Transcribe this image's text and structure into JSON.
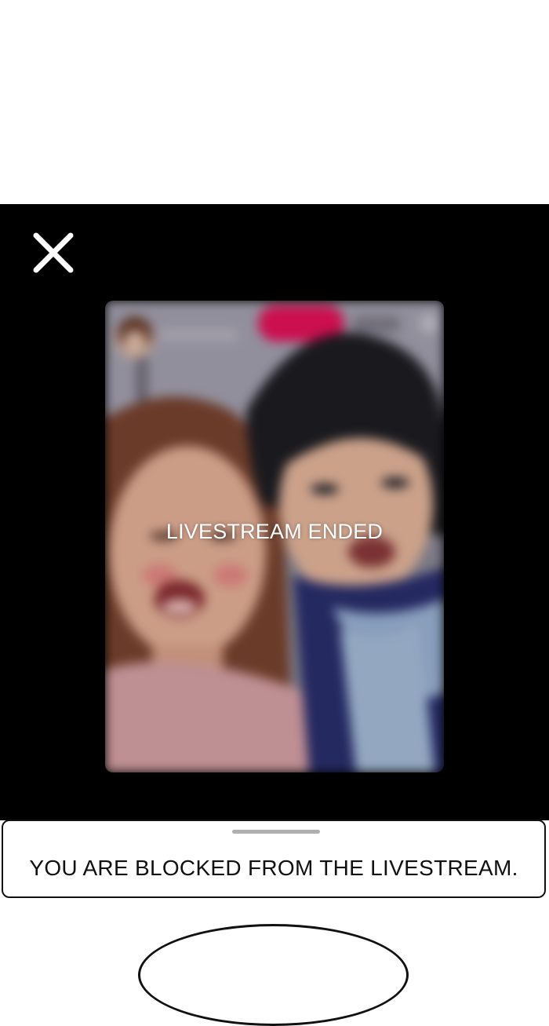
{
  "stream": {
    "status_text": "LIVESTREAM ENDED",
    "close_icon": "close-icon"
  },
  "sheet": {
    "message": "YOU ARE BLOCKED FROM THE LIVESTREAM."
  },
  "colors": {
    "screen_background": "#000000",
    "page_background": "#ffffff",
    "live_badge": "#e8125a"
  }
}
